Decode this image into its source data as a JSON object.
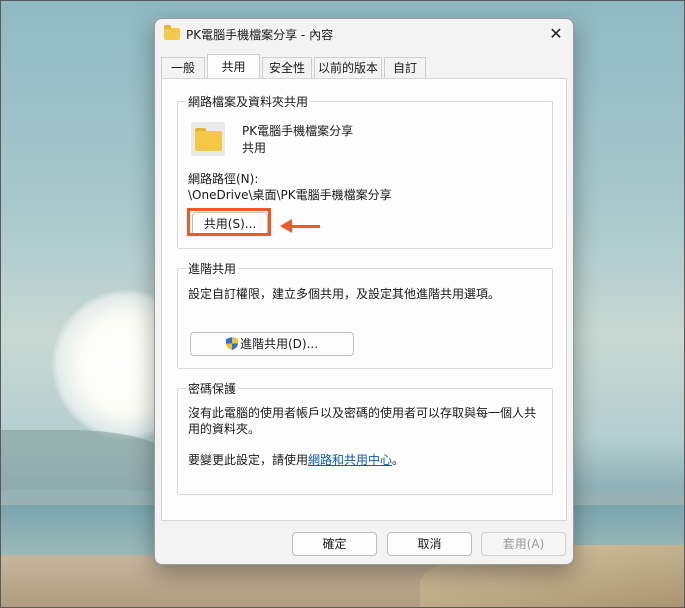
{
  "dialog": {
    "title": "PK電腦手機檔案分享 - 內容",
    "close_label": "✕"
  },
  "tabs": [
    {
      "label": "一般",
      "active": false
    },
    {
      "label": "共用",
      "active": true
    },
    {
      "label": "安全性",
      "active": false
    },
    {
      "label": "以前的版本",
      "active": false
    },
    {
      "label": "自訂",
      "active": false
    }
  ],
  "network_sharing": {
    "group_title": "網路檔案及資料夾共用",
    "folder_name": "PK電腦手機檔案分享",
    "status": "共用",
    "path_label": "網路路徑(N):",
    "path_value": "\\OneDrive\\桌面\\PK電腦手機檔案分享",
    "share_button": "共用(S)..."
  },
  "advanced_sharing": {
    "group_title": "進階共用",
    "description": "設定自訂權限，建立多個共用，及設定其他進階共用選項。",
    "button": "進階共用(D)..."
  },
  "password_protection": {
    "group_title": "密碼保護",
    "description": "沒有此電腦的使用者帳戶以及密碼的使用者可以存取與每一個人共用的資料夾。",
    "change_prefix": "要變更此設定，請使用",
    "change_link": "網路和共用中心",
    "change_suffix": "。"
  },
  "footer": {
    "ok": "確定",
    "cancel": "取消",
    "apply": "套用(A)"
  },
  "annotation": {
    "color": "#f05a22"
  }
}
